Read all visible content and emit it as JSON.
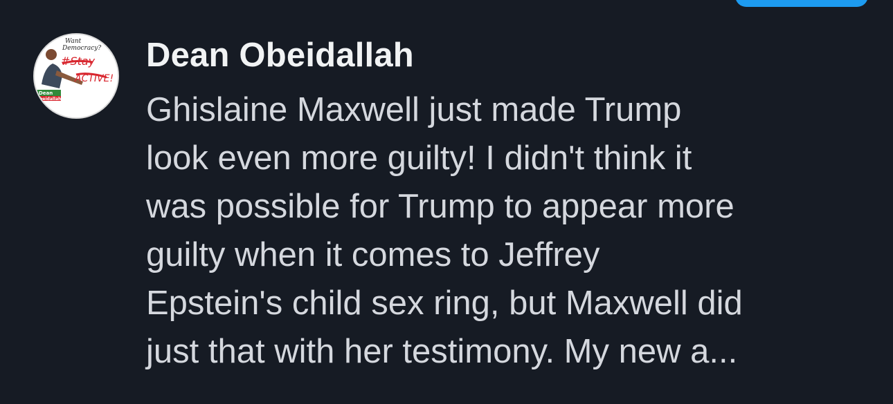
{
  "post": {
    "author_name": "Dean Obeidallah",
    "body_text": "Ghislaine Maxwell just made Trump\nlook even more guilty! I didn't think it\nwas possible for Trump to appear more\nguilty when it comes to Jeffrey\nEpstein's child sex ring, but Maxwell did\njust that with her testimony. My new a...",
    "avatar": {
      "logo_text_1": "Want",
      "logo_text_2": "Democracy?",
      "logo_text_3": "#Stay",
      "logo_text_4": "ACTIVE!",
      "logo_text_5": "Dean",
      "logo_text_6": "Obeidallah"
    }
  },
  "colors": {
    "background": "#161b24",
    "accent": "#1d9bf0",
    "author_text": "#f1f3f4",
    "body_text": "#d5d8de"
  }
}
